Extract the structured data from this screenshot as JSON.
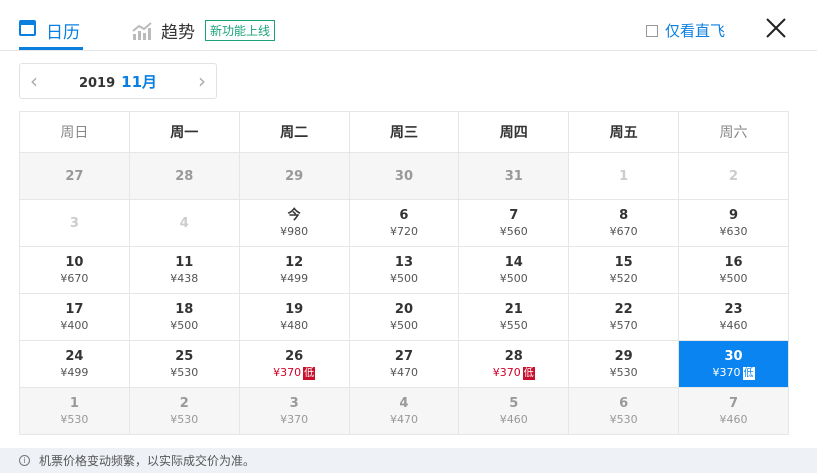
{
  "tabs": {
    "calendar": "日历",
    "trend": "趋势",
    "new_badge": "新功能上线"
  },
  "direct_only": {
    "label": "仅看直飞",
    "checked": false
  },
  "month_selector": {
    "year": "2019",
    "month": "11月"
  },
  "weekdays": [
    "周日",
    "周一",
    "周二",
    "周三",
    "周四",
    "周五",
    "周六"
  ],
  "low_tag": "低",
  "weeks": [
    [
      {
        "d": "27",
        "p": "",
        "s": "gray"
      },
      {
        "d": "28",
        "p": "",
        "s": "gray"
      },
      {
        "d": "29",
        "p": "",
        "s": "gray"
      },
      {
        "d": "30",
        "p": "",
        "s": "gray"
      },
      {
        "d": "31",
        "p": "",
        "s": "gray"
      },
      {
        "d": "1",
        "p": "",
        "s": "dis"
      },
      {
        "d": "2",
        "p": "",
        "s": "dis"
      }
    ],
    [
      {
        "d": "3",
        "p": "",
        "s": "dis"
      },
      {
        "d": "4",
        "p": "",
        "s": "dis"
      },
      {
        "d": "今",
        "p": "¥980",
        "s": ""
      },
      {
        "d": "6",
        "p": "¥720",
        "s": ""
      },
      {
        "d": "7",
        "p": "¥560",
        "s": ""
      },
      {
        "d": "8",
        "p": "¥670",
        "s": ""
      },
      {
        "d": "9",
        "p": "¥630",
        "s": ""
      }
    ],
    [
      {
        "d": "10",
        "p": "¥670",
        "s": ""
      },
      {
        "d": "11",
        "p": "¥438",
        "s": ""
      },
      {
        "d": "12",
        "p": "¥499",
        "s": ""
      },
      {
        "d": "13",
        "p": "¥500",
        "s": ""
      },
      {
        "d": "14",
        "p": "¥500",
        "s": ""
      },
      {
        "d": "15",
        "p": "¥520",
        "s": ""
      },
      {
        "d": "16",
        "p": "¥500",
        "s": ""
      }
    ],
    [
      {
        "d": "17",
        "p": "¥400",
        "s": ""
      },
      {
        "d": "18",
        "p": "¥500",
        "s": ""
      },
      {
        "d": "19",
        "p": "¥480",
        "s": ""
      },
      {
        "d": "20",
        "p": "¥500",
        "s": ""
      },
      {
        "d": "21",
        "p": "¥550",
        "s": ""
      },
      {
        "d": "22",
        "p": "¥570",
        "s": ""
      },
      {
        "d": "23",
        "p": "¥460",
        "s": ""
      }
    ],
    [
      {
        "d": "24",
        "p": "¥499",
        "s": ""
      },
      {
        "d": "25",
        "p": "¥530",
        "s": ""
      },
      {
        "d": "26",
        "p": "¥370",
        "s": "low"
      },
      {
        "d": "27",
        "p": "¥470",
        "s": ""
      },
      {
        "d": "28",
        "p": "¥370",
        "s": "low"
      },
      {
        "d": "29",
        "p": "¥530",
        "s": ""
      },
      {
        "d": "30",
        "p": "¥370",
        "s": "low sel"
      }
    ],
    [
      {
        "d": "1",
        "p": "¥530",
        "s": "gray"
      },
      {
        "d": "2",
        "p": "¥530",
        "s": "gray"
      },
      {
        "d": "3",
        "p": "¥370",
        "s": "gray"
      },
      {
        "d": "4",
        "p": "¥470",
        "s": "gray"
      },
      {
        "d": "5",
        "p": "¥460",
        "s": "gray"
      },
      {
        "d": "6",
        "p": "¥530",
        "s": "gray"
      },
      {
        "d": "7",
        "p": "¥460",
        "s": "gray"
      }
    ]
  ],
  "footer": {
    "note": "机票价格变动频繁，以实际成交价为准。"
  },
  "colors": {
    "accent": "#0a84f0",
    "low": "#c8102e",
    "badge": "#1aa37a"
  }
}
